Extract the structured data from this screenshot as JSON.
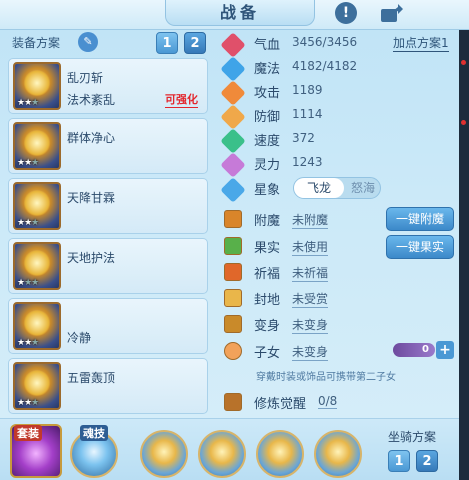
{
  "header": {
    "title": "战备"
  },
  "left": {
    "plan_label": "装备方案",
    "plan_tabs": [
      "1",
      "2"
    ],
    "skills": [
      {
        "name": "乱刃斩",
        "sub": "法术紊乱",
        "upgrade": "可强化"
      },
      {
        "name": "群体净心"
      },
      {
        "name": "天降甘霖"
      },
      {
        "name": "天地护法"
      },
      {
        "name": "冷静"
      },
      {
        "name": "五雷轰顶"
      }
    ]
  },
  "stats": {
    "scheme_link": "加点方案1",
    "rows": [
      {
        "label": "气血",
        "value": "3456/3456",
        "color": "#e0506a"
      },
      {
        "label": "魔法",
        "value": "4182/4182",
        "color": "#3fa4e8"
      },
      {
        "label": "攻击",
        "value": "1189",
        "color": "#f08a3a"
      },
      {
        "label": "防御",
        "value": "1114",
        "color": "#f0a84a"
      },
      {
        "label": "速度",
        "value": "372",
        "color": "#3ac08a"
      },
      {
        "label": "灵力",
        "value": "1243",
        "color": "#c67ad8"
      }
    ],
    "star_label": "星象",
    "star_on": "飞龙",
    "star_off": "怒海"
  },
  "slots": {
    "rows": [
      {
        "label": "附魔",
        "value": "未附魔"
      },
      {
        "label": "果实",
        "value": "未使用"
      },
      {
        "label": "祈福",
        "value": "未祈福"
      },
      {
        "label": "封地",
        "value": "未受赏"
      },
      {
        "label": "变身",
        "value": "未变身"
      },
      {
        "label": "子女",
        "value": "未变身"
      }
    ],
    "enchant_btn": "一键附魔",
    "fruit_btn": "一键果实",
    "child_count": "0",
    "hint": "穿戴时装或饰品可携带第二子女",
    "awaken_label": "修炼觉醒",
    "awaken_value": "0/8"
  },
  "bottom": {
    "suit_tag": "套装",
    "soul_tag": "魂技",
    "mount_label": "坐骑方案",
    "mount_tabs": [
      "1",
      "2"
    ]
  }
}
